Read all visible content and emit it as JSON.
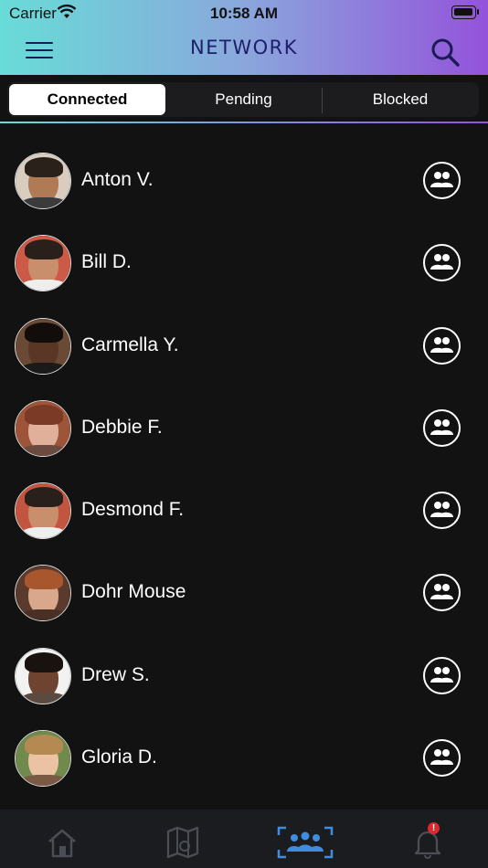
{
  "status_bar": {
    "carrier": "Carrier",
    "time": "10:58 AM"
  },
  "header": {
    "title": "NETWORK",
    "menu_icon": "hamburger-icon",
    "search_icon": "search-icon"
  },
  "tabs": [
    {
      "label": "Connected",
      "active": true
    },
    {
      "label": "Pending",
      "active": false
    },
    {
      "label": "Blocked",
      "active": false
    }
  ],
  "contacts": [
    {
      "name": "Anton V."
    },
    {
      "name": "Bill D."
    },
    {
      "name": "Carmella Y."
    },
    {
      "name": "Debbie F."
    },
    {
      "name": "Desmond F."
    },
    {
      "name": "Dohr Mouse"
    },
    {
      "name": "Drew S."
    },
    {
      "name": "Gloria D."
    }
  ],
  "bottom_nav": [
    {
      "icon": "home-icon",
      "active": false
    },
    {
      "icon": "map-icon",
      "active": false
    },
    {
      "icon": "network-icon",
      "active": true
    },
    {
      "icon": "bell-icon",
      "active": false,
      "badge": "!"
    }
  ],
  "colors": {
    "accent": "#3f8de0",
    "header_start": "#68dcd7",
    "header_end": "#9353db",
    "badge": "#e0262b"
  }
}
